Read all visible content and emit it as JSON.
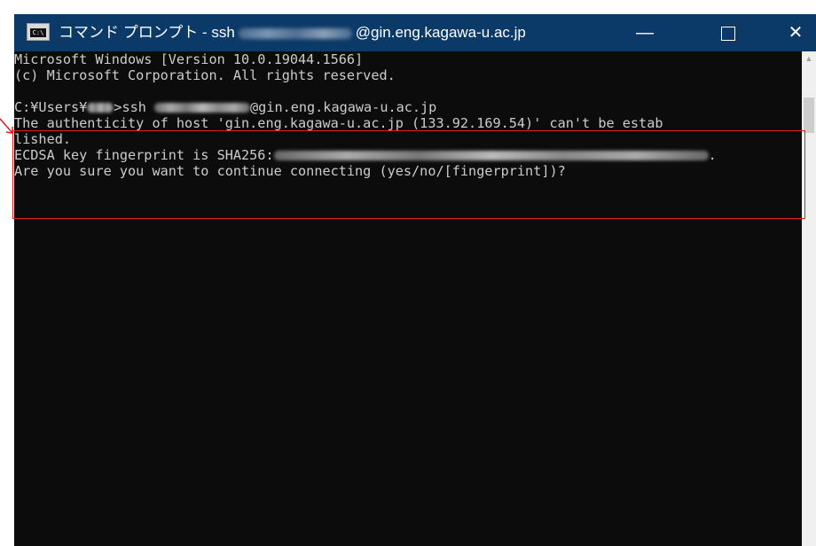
{
  "window": {
    "icon_label": "C:\\",
    "title_prefix": "コマンド プロンプト - ssh",
    "title_suffix": "@gin.eng.kagawa-u.ac.jp",
    "min_label": "—",
    "close_label": "✕"
  },
  "console": {
    "line1": "Microsoft Windows [Version 10.0.19044.1566]",
    "line2": "(c) Microsoft Corporation. All rights reserved.",
    "line3_a": "C:¥Users¥",
    "line3_b": ">ssh ",
    "line3_c": "@gin.eng.kagawa-u.ac.jp",
    "line4": "The authenticity of host 'gin.eng.kagawa-u.ac.jp (133.92.169.54)' can't be estab",
    "line5": "lished.",
    "line6_a": "ECDSA key fingerprint is SHA256:",
    "line6_b": ".",
    "line7": "Are you sure you want to continue connecting (yes/no/[fingerprint])?"
  },
  "colors": {
    "titlebar": "#0b3a68",
    "console_bg": "#0c0c0c",
    "console_text": "#cccccc",
    "annotation": "#e81b1b"
  }
}
